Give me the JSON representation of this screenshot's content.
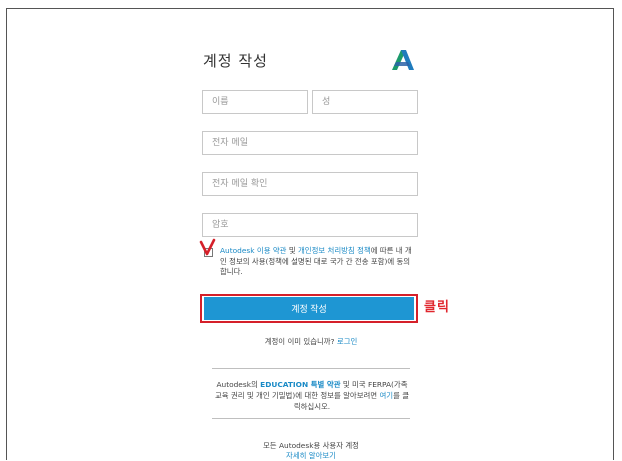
{
  "form": {
    "title": "계정 작성",
    "first_name_placeholder": "이름",
    "last_name_placeholder": "성",
    "email_placeholder": "전자 메일",
    "email_confirm_placeholder": "전자 메일 확인",
    "password_placeholder": "암호",
    "agree": {
      "brand": "Autodesk",
      "terms_link": "이용 약관",
      "and": "및",
      "privacy_link": "개인정보 처리방침 정책",
      "rest": "에 따른 내 개인 정보의 사용(정책에 설명된 대로 국가 간 전송 포함)에 동의합니다."
    },
    "submit_label": "계정 작성",
    "annotation": "클릭",
    "has_account_text": "계정이 이미 있습니까?",
    "login_link": "로그인"
  },
  "education": {
    "prefix": "Autodesk의",
    "edu_link": "EDUCATION 특별 약관",
    "middle": "및 미국 FERPA(가족 교육 권리 및 개인 기밀법)에 대한 정보를 알아보려면",
    "here_link": "여기",
    "suffix": "를 클릭하십시오."
  },
  "footer": {
    "line1": "모든 Autodesk용 사용자 계정",
    "learn_more": "자세히 알아보기"
  },
  "colors": {
    "accent": "#1e96d3",
    "annotation_red": "#d5202a",
    "link": "#1a8ac6"
  }
}
